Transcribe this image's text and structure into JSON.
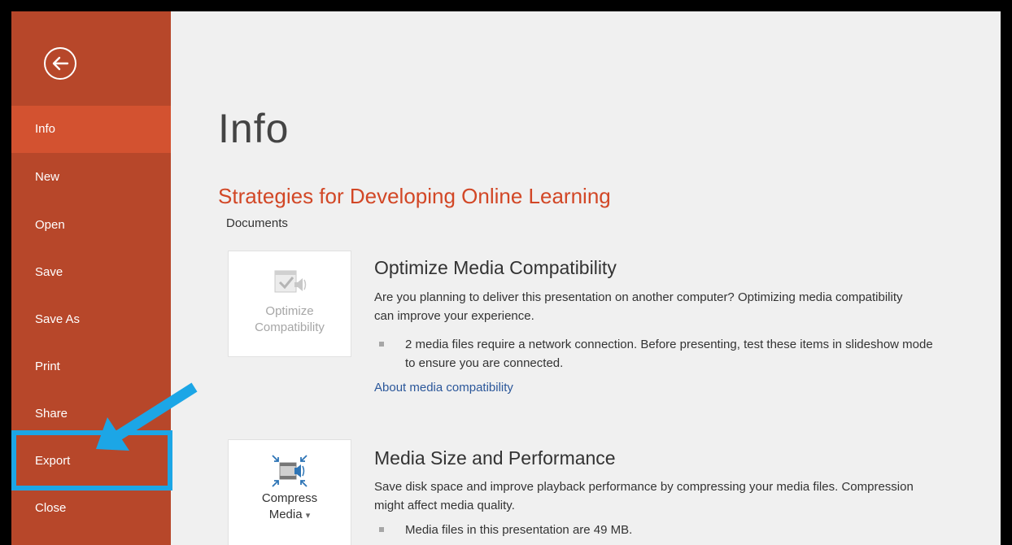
{
  "sidebar": {
    "back_icon": "back-arrow-icon",
    "items": [
      {
        "label": "Info",
        "active": true
      },
      {
        "label": "New"
      },
      {
        "label": "Open"
      },
      {
        "label": "Save"
      },
      {
        "label": "Save As"
      },
      {
        "label": "Print"
      },
      {
        "label": "Share"
      },
      {
        "label": "Export"
      },
      {
        "label": "Close"
      }
    ]
  },
  "main": {
    "page_title": "Info",
    "doc_title": "Strategies for Developing Online Learning",
    "doc_location": "Documents",
    "optimize": {
      "tile_line1": "Optimize",
      "tile_line2": "Compatibility",
      "heading": "Optimize Media Compatibility",
      "description": "Are you planning to deliver this presentation on another computer? Optimizing media compatibility can improve your experience.",
      "bullet": "2 media files require a network connection. Before presenting, test these items in slideshow mode to ensure you are connected.",
      "link": "About media compatibility"
    },
    "compress": {
      "tile_line1": "Compress",
      "tile_line2": "Media",
      "tile_caret": "▾",
      "heading": "Media Size and Performance",
      "description": "Save disk space and improve playback performance by compressing your media files. Compression might affect media quality.",
      "bullet": "Media files in this presentation are 49 MB."
    }
  },
  "colors": {
    "sidebar": "#b7472a",
    "sidebar_active": "#d35230",
    "doc_title": "#d24726",
    "link": "#2b579a",
    "annotation": "#1ca6e6"
  }
}
